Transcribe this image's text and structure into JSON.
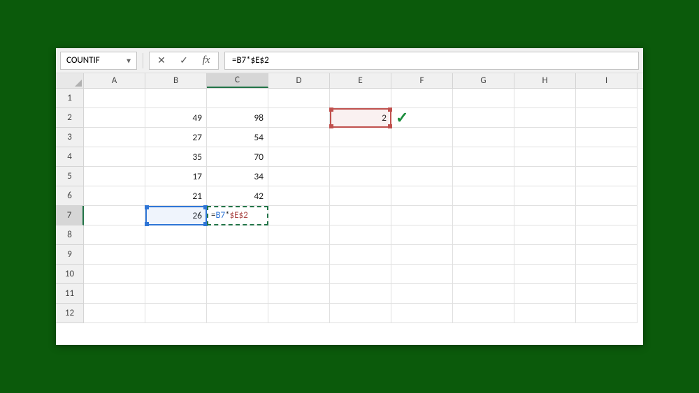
{
  "namebox": {
    "value": "COUNTIF"
  },
  "formula_bar": {
    "cancel_icon": "✕",
    "enter_icon": "✓",
    "fx_label": "fx",
    "value": "=B7*$E$2"
  },
  "columns": [
    "A",
    "B",
    "C",
    "D",
    "E",
    "F",
    "G",
    "H",
    "I"
  ],
  "active_column": "C",
  "rows_visible": [
    1,
    2,
    3,
    4,
    5,
    6,
    7,
    8,
    9,
    10,
    11,
    12
  ],
  "active_row": 7,
  "cells": {
    "B2": "49",
    "C2": "98",
    "E2": "2",
    "B3": "27",
    "C3": "54",
    "B4": "35",
    "C4": "70",
    "B5": "17",
    "C5": "34",
    "B6": "21",
    "C6": "42",
    "B7": "26"
  },
  "editing": {
    "address": "C7",
    "display": "=B7*$E$2",
    "parts": {
      "prefix": "=",
      "ref1": "B7",
      "op": "*",
      "ref2": "$E$2"
    }
  },
  "overlay_check_icon": "✓",
  "chart_data": {
    "type": "table",
    "columns": [
      "A",
      "B",
      "C",
      "D",
      "E",
      "F",
      "G",
      "H",
      "I"
    ],
    "rows": [
      {
        "row": 1
      },
      {
        "row": 2,
        "B": 49,
        "C": 98,
        "E": 2
      },
      {
        "row": 3,
        "B": 27,
        "C": 54
      },
      {
        "row": 4,
        "B": 35,
        "C": 70
      },
      {
        "row": 5,
        "B": 17,
        "C": 34
      },
      {
        "row": 6,
        "B": 21,
        "C": 42
      },
      {
        "row": 7,
        "B": 26,
        "C": "=B7*$E$2"
      }
    ],
    "active_cell": "C7",
    "formula": "=B7*$E$2"
  }
}
